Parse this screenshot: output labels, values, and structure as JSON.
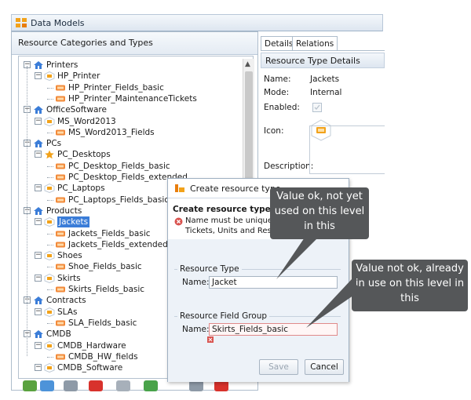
{
  "window": {
    "title": "Data Models"
  },
  "left_panel": {
    "header": "Resource Categories and Types",
    "tree": [
      {
        "label": "Printers",
        "level": 0,
        "kind": "category",
        "toggle": "−"
      },
      {
        "label": "HP_Printer",
        "level": 1,
        "kind": "type",
        "toggle": "−"
      },
      {
        "label": "HP_Printer_Fields_basic",
        "level": 2,
        "kind": "field"
      },
      {
        "label": "HP_Printer_MaintenanceTickets",
        "level": 2,
        "kind": "field"
      },
      {
        "label": "OfficeSoftware",
        "level": 0,
        "kind": "category",
        "toggle": "−"
      },
      {
        "label": "MS_Word2013",
        "level": 1,
        "kind": "type",
        "toggle": "−"
      },
      {
        "label": "MS_Word2013_Fields",
        "level": 2,
        "kind": "field"
      },
      {
        "label": "PCs",
        "level": 0,
        "kind": "category",
        "toggle": "−"
      },
      {
        "label": "PC_Desktops",
        "level": 1,
        "kind": "star",
        "toggle": "−"
      },
      {
        "label": "PC_Desktop_Fields_basic",
        "level": 2,
        "kind": "field"
      },
      {
        "label": "PC_Desktop_Fields_extended",
        "level": 2,
        "kind": "field"
      },
      {
        "label": "PC_Laptops",
        "level": 1,
        "kind": "type",
        "toggle": "−"
      },
      {
        "label": "PC_Laptops_Fields_basic",
        "level": 2,
        "kind": "field"
      },
      {
        "label": "Products",
        "level": 0,
        "kind": "category",
        "toggle": "−"
      },
      {
        "label": "Jackets",
        "level": 1,
        "kind": "type",
        "toggle": "−",
        "selected": true
      },
      {
        "label": "Jackets_Fields_basic",
        "level": 2,
        "kind": "field"
      },
      {
        "label": "Jackets_Fields_extended",
        "level": 2,
        "kind": "field"
      },
      {
        "label": "Shoes",
        "level": 1,
        "kind": "type",
        "toggle": "−"
      },
      {
        "label": "Shoe_Fields_basic",
        "level": 2,
        "kind": "field"
      },
      {
        "label": "Skirts",
        "level": 1,
        "kind": "type",
        "toggle": "−"
      },
      {
        "label": "Skirts_Fields_basic",
        "level": 2,
        "kind": "field"
      },
      {
        "label": "Contracts",
        "level": 0,
        "kind": "category",
        "toggle": "−"
      },
      {
        "label": "SLAs",
        "level": 1,
        "kind": "type",
        "toggle": "−"
      },
      {
        "label": "SLA_Fields_basic",
        "level": 2,
        "kind": "field"
      },
      {
        "label": "CMDB",
        "level": 0,
        "kind": "category",
        "toggle": "−"
      },
      {
        "label": "CMDB_Hardware",
        "level": 1,
        "kind": "type",
        "toggle": "−"
      },
      {
        "label": "CMDB_HW_fields",
        "level": 2,
        "kind": "field"
      },
      {
        "label": "CMDB_Software",
        "level": 1,
        "kind": "type",
        "toggle": "−"
      }
    ]
  },
  "right_panel": {
    "tabs": [
      "Details",
      "Relations"
    ],
    "section_title": "Resource Type Details",
    "name_label": "Name:",
    "name_value": "Jackets",
    "mode_label": "Mode:",
    "mode_value": "Internal",
    "enabled_label": "Enabled:",
    "icon_label": "Icon:",
    "description_label": "Description:"
  },
  "dialog": {
    "title": "Create resource type",
    "heading": "Create resource type",
    "error_line1": "Name must be unique for",
    "error_line2": "Tickets, Units and Resour",
    "group1_label": "Resource Type",
    "name_label_1": "Name:",
    "name_value_1": "Jacket",
    "group2_label": "Resource Field Group",
    "name_label_2": "Name:",
    "name_value_2": "Skirts_Fields_basic",
    "save_label": "Save",
    "cancel_label": "Cancel"
  },
  "callouts": {
    "ok_text": "Value ok, not yet used on this level in this",
    "bad_text": "Value not ok, already in use on this level in this"
  },
  "colors": {
    "selection": "#3b7dd8",
    "callout": "#555759",
    "error": "#d9534f"
  }
}
